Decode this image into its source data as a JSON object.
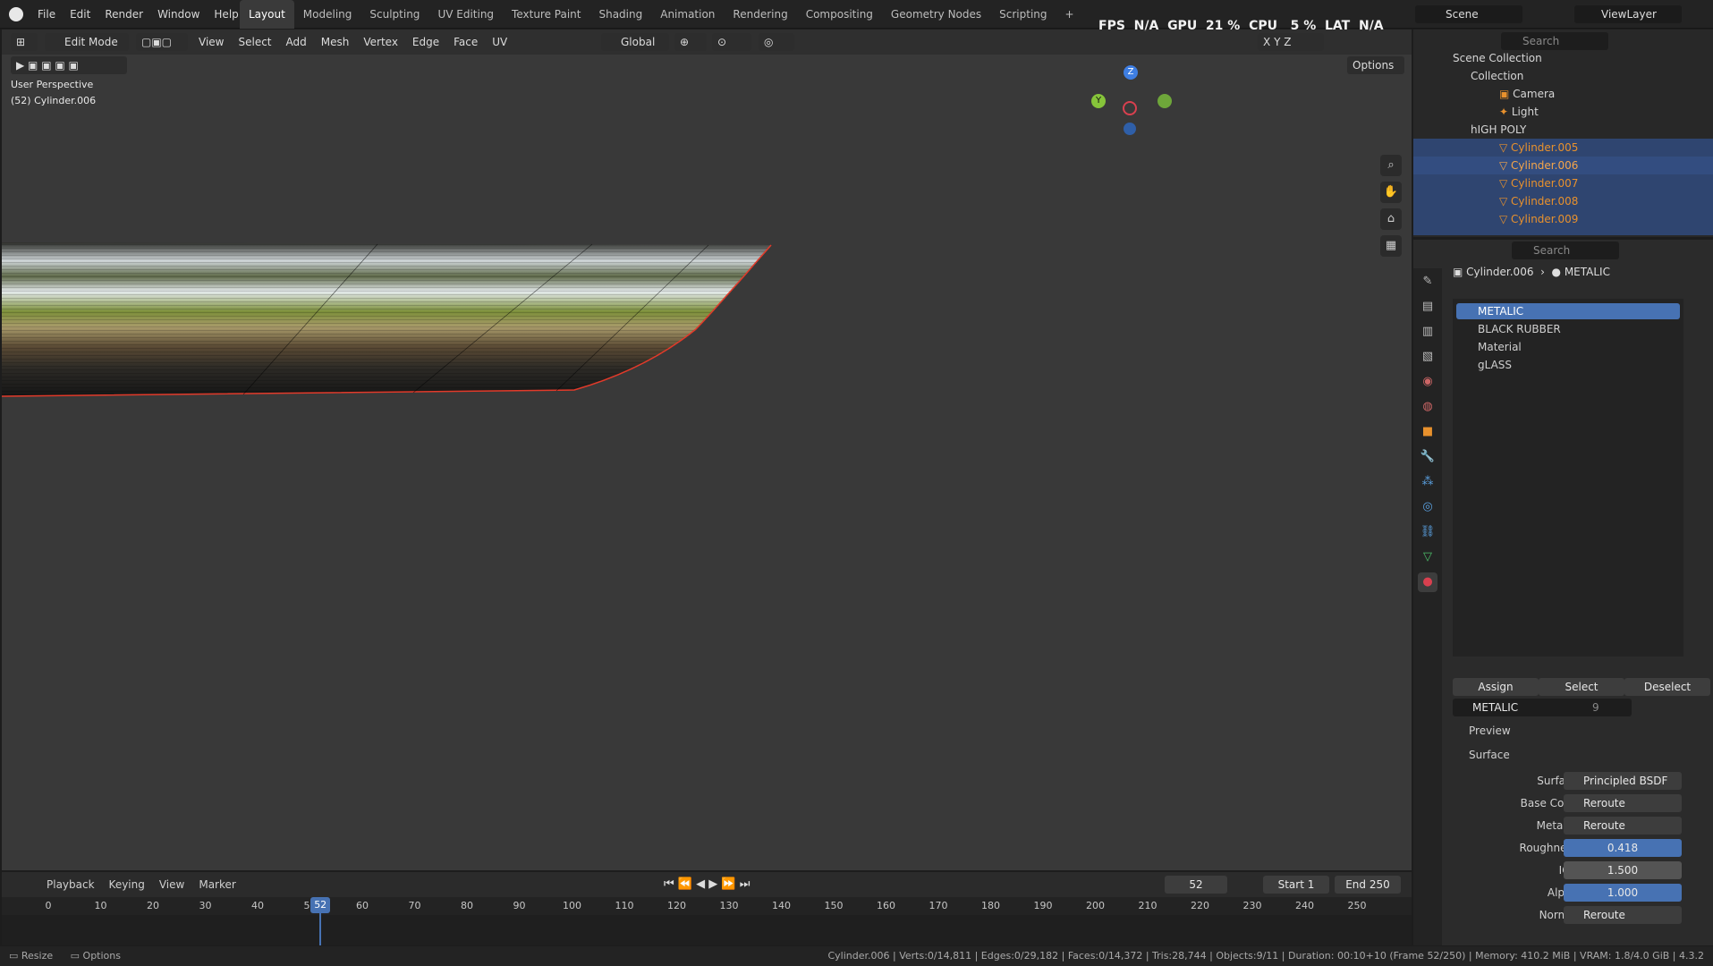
{
  "topbar": {
    "menus": [
      "File",
      "Edit",
      "Render",
      "Window",
      "Help"
    ],
    "workspaces": [
      "Layout",
      "Modeling",
      "Sculpting",
      "UV Editing",
      "Texture Paint",
      "Shading",
      "Animation",
      "Rendering",
      "Compositing",
      "Geometry Nodes",
      "Scripting"
    ],
    "add_icon": "plus-icon",
    "scene": "Scene",
    "view_layer": "ViewLayer"
  },
  "viewport": {
    "mode": "Edit Mode",
    "menus": [
      "View",
      "Select",
      "Add",
      "Mesh",
      "Vertex",
      "Edge",
      "Face",
      "UV"
    ],
    "orientation": "Global",
    "perspective": "User Perspective",
    "object_info": "(52) Cylinder.006",
    "overlay_text": "FPS  N/A  GPU  21 %  CPU   5 %  LAT  N/A",
    "axes": [
      "X",
      "Y",
      "Z"
    ],
    "options": "Options",
    "gizmo": {
      "x": "X",
      "y": "Y",
      "z": "Z"
    }
  },
  "outliner": {
    "search_placeholder": "Search",
    "scene_collection": "Scene Collection",
    "collection": "Collection",
    "camera": "Camera",
    "light": "Light",
    "high_poly": "hIGH POLY",
    "objects": [
      "Cylinder.005",
      "Cylinder.006",
      "Cylinder.007",
      "Cylinder.008",
      "Cylinder.009"
    ]
  },
  "properties": {
    "search_placeholder": "Search",
    "breadcrumb_object": "Cylinder.006",
    "breadcrumb_material": "METALIC",
    "slots": [
      "METALIC",
      "BLACK RUBBER",
      "Material",
      "gLASS"
    ],
    "assign": "Assign",
    "select": "Select",
    "deselect": "Deselect",
    "material_name": "METALIC",
    "user_count": "9",
    "preview": "Preview",
    "surface_panel": "Surface",
    "surface_label": "Surface",
    "surface_value": "Principled BSDF",
    "rows": [
      {
        "label": "Base Color",
        "value": "Reroute"
      },
      {
        "label": "Metallic",
        "value": "Reroute"
      },
      {
        "label": "Roughness",
        "value": "0.418"
      },
      {
        "label": "IOR",
        "value": "1.500"
      },
      {
        "label": "Alpha",
        "value": "1.000"
      },
      {
        "label": "Normal",
        "value": "Reroute"
      }
    ],
    "colors": {
      "accent": "#4772b3",
      "selected_row": "#334d80",
      "object_orange": "#e8912d"
    }
  },
  "timeline": {
    "menus": [
      "Playback",
      "Keying",
      "View",
      "Marker"
    ],
    "current_frame": "52",
    "start_label": "Start",
    "start": "1",
    "end_label": "End",
    "end": "250",
    "ticks": [
      "0",
      "10",
      "20",
      "30",
      "40",
      "50",
      "60",
      "70",
      "80",
      "90",
      "100",
      "110",
      "120",
      "130",
      "140",
      "150",
      "160",
      "170",
      "180",
      "190",
      "200",
      "210",
      "220",
      "230",
      "240",
      "250"
    ],
    "playhead": "52"
  },
  "status": {
    "left1": "Resize",
    "left2": "Options",
    "right": "Cylinder.006 | Verts:0/14,811 | Edges:0/29,182 | Faces:0/14,372 | Tris:28,744 | Objects:9/11 | Duration: 00:10+10 (Frame 52/250) | Memory: 410.2 MiB | VRAM: 1.8/4.0 GiB | 4.3.2"
  }
}
